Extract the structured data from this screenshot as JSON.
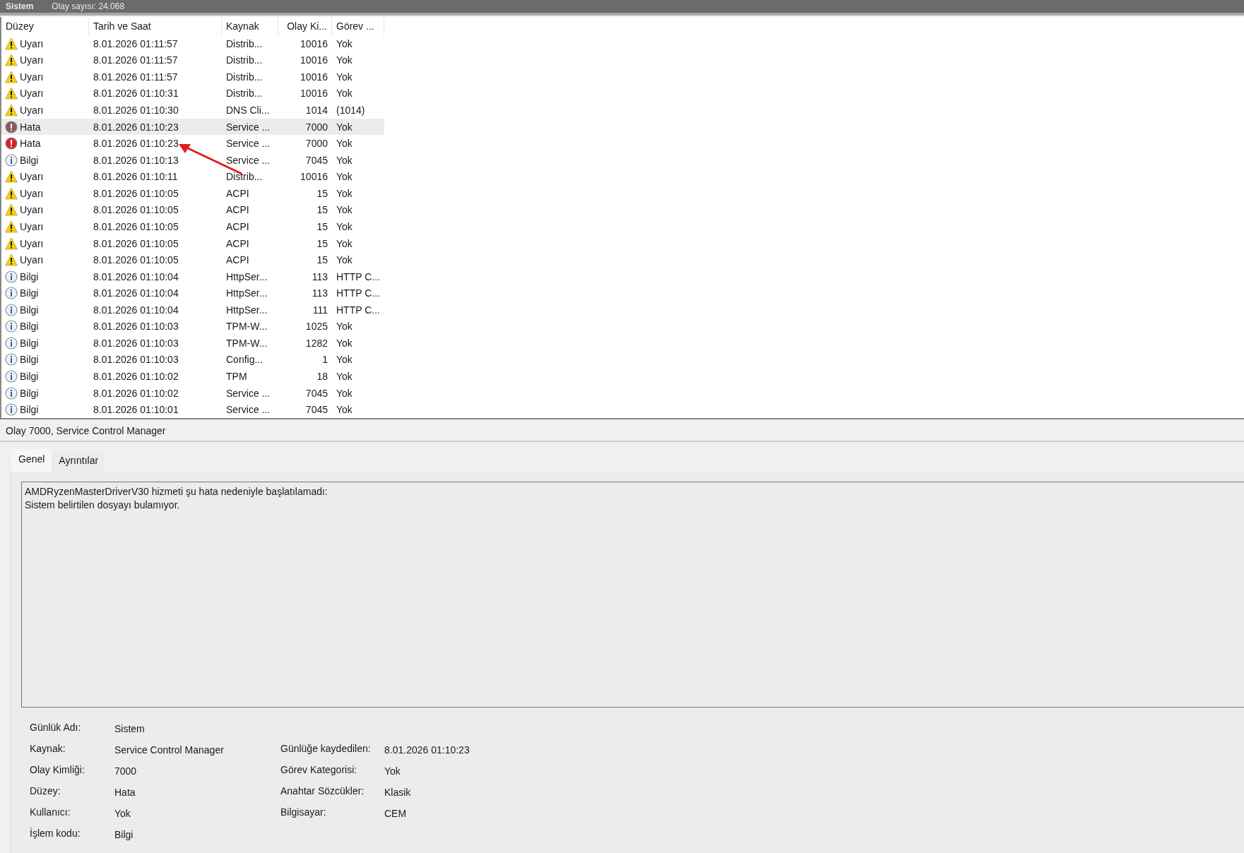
{
  "title_bar": {
    "log_name": "Sistem",
    "event_count": "Olay sayısı: 24.068"
  },
  "table": {
    "columns": [
      "Düzey",
      "Tarih ve Saat",
      "Kaynak",
      "Olay Ki...",
      "Görev ..."
    ],
    "rows": [
      {
        "kind": "warning",
        "level": "Uyarı",
        "date": "8.01.2026 01:11:57",
        "source": "Distrib...",
        "event_id": "10016",
        "task": "Yok",
        "selected": false
      },
      {
        "kind": "warning",
        "level": "Uyarı",
        "date": "8.01.2026 01:11:57",
        "source": "Distrib...",
        "event_id": "10016",
        "task": "Yok",
        "selected": false
      },
      {
        "kind": "warning",
        "level": "Uyarı",
        "date": "8.01.2026 01:11:57",
        "source": "Distrib...",
        "event_id": "10016",
        "task": "Yok",
        "selected": false
      },
      {
        "kind": "warning",
        "level": "Uyarı",
        "date": "8.01.2026 01:10:31",
        "source": "Distrib...",
        "event_id": "10016",
        "task": "Yok",
        "selected": false
      },
      {
        "kind": "warning",
        "level": "Uyarı",
        "date": "8.01.2026 01:10:30",
        "source": "DNS Cli...",
        "event_id": "1014",
        "task": "(1014)",
        "selected": false
      },
      {
        "kind": "error",
        "level": "Hata",
        "date": "8.01.2026 01:10:23",
        "source": "Service ...",
        "event_id": "7000",
        "task": "Yok",
        "selected": true
      },
      {
        "kind": "error",
        "level": "Hata",
        "date": "8.01.2026 01:10:23",
        "source": "Service ...",
        "event_id": "7000",
        "task": "Yok",
        "selected": false
      },
      {
        "kind": "info",
        "level": "Bilgi",
        "date": "8.01.2026 01:10:13",
        "source": "Service ...",
        "event_id": "7045",
        "task": "Yok",
        "selected": false
      },
      {
        "kind": "warning",
        "level": "Uyarı",
        "date": "8.01.2026 01:10:11",
        "source": "Distrib...",
        "event_id": "10016",
        "task": "Yok",
        "selected": false
      },
      {
        "kind": "warning",
        "level": "Uyarı",
        "date": "8.01.2026 01:10:05",
        "source": "ACPI",
        "event_id": "15",
        "task": "Yok",
        "selected": false
      },
      {
        "kind": "warning",
        "level": "Uyarı",
        "date": "8.01.2026 01:10:05",
        "source": "ACPI",
        "event_id": "15",
        "task": "Yok",
        "selected": false
      },
      {
        "kind": "warning",
        "level": "Uyarı",
        "date": "8.01.2026 01:10:05",
        "source": "ACPI",
        "event_id": "15",
        "task": "Yok",
        "selected": false
      },
      {
        "kind": "warning",
        "level": "Uyarı",
        "date": "8.01.2026 01:10:05",
        "source": "ACPI",
        "event_id": "15",
        "task": "Yok",
        "selected": false
      },
      {
        "kind": "warning",
        "level": "Uyarı",
        "date": "8.01.2026 01:10:05",
        "source": "ACPI",
        "event_id": "15",
        "task": "Yok",
        "selected": false
      },
      {
        "kind": "info",
        "level": "Bilgi",
        "date": "8.01.2026 01:10:04",
        "source": "HttpSer...",
        "event_id": "113",
        "task": "HTTP C...",
        "selected": false
      },
      {
        "kind": "info",
        "level": "Bilgi",
        "date": "8.01.2026 01:10:04",
        "source": "HttpSer...",
        "event_id": "113",
        "task": "HTTP C...",
        "selected": false
      },
      {
        "kind": "info",
        "level": "Bilgi",
        "date": "8.01.2026 01:10:04",
        "source": "HttpSer...",
        "event_id": "111",
        "task": "HTTP C...",
        "selected": false
      },
      {
        "kind": "info",
        "level": "Bilgi",
        "date": "8.01.2026 01:10:03",
        "source": "TPM-W...",
        "event_id": "1025",
        "task": "Yok",
        "selected": false
      },
      {
        "kind": "info",
        "level": "Bilgi",
        "date": "8.01.2026 01:10:03",
        "source": "TPM-W...",
        "event_id": "1282",
        "task": "Yok",
        "selected": false
      },
      {
        "kind": "info",
        "level": "Bilgi",
        "date": "8.01.2026 01:10:03",
        "source": "Config...",
        "event_id": "1",
        "task": "Yok",
        "selected": false
      },
      {
        "kind": "info",
        "level": "Bilgi",
        "date": "8.01.2026 01:10:02",
        "source": "TPM",
        "event_id": "18",
        "task": "Yok",
        "selected": false
      },
      {
        "kind": "info",
        "level": "Bilgi",
        "date": "8.01.2026 01:10:02",
        "source": "Service ...",
        "event_id": "7045",
        "task": "Yok",
        "selected": false
      },
      {
        "kind": "info",
        "level": "Bilgi",
        "date": "8.01.2026 01:10:01",
        "source": "Service ...",
        "event_id": "7045",
        "task": "Yok",
        "selected": false
      }
    ]
  },
  "details": {
    "title": "Olay 7000, Service Control Manager",
    "tabs": [
      {
        "label": "Genel",
        "selected": true
      },
      {
        "label": "Ayrıntılar",
        "selected": false
      }
    ],
    "message": [
      "AMDRyzenMasterDriverV30 hizmeti şu hata nedeniyle başlatılamadı:",
      "Sistem belirtilen dosyayı bulamıyor."
    ],
    "properties_left": [
      {
        "label": "Günlük Adı:",
        "value": "Sistem"
      },
      {
        "label": "Kaynak:",
        "value": "Service Control Manager"
      },
      {
        "label": "Olay Kimliği:",
        "value": "7000"
      },
      {
        "label": "Düzey:",
        "value": "Hata"
      },
      {
        "label": "Kullanıcı:",
        "value": "Yok"
      },
      {
        "label": "İşlem kodu:",
        "value": "Bilgi"
      }
    ],
    "properties_right": [
      {
        "label": "Günlüğe kaydedilen:",
        "value": "8.01.2026 01:10:23"
      },
      {
        "label": "Görev Kategorisi:",
        "value": "Yok"
      },
      {
        "label": "Anahtar Sözcükler:",
        "value": "Klasik"
      },
      {
        "label": "Bilgisayar:",
        "value": "CEM"
      }
    ]
  }
}
